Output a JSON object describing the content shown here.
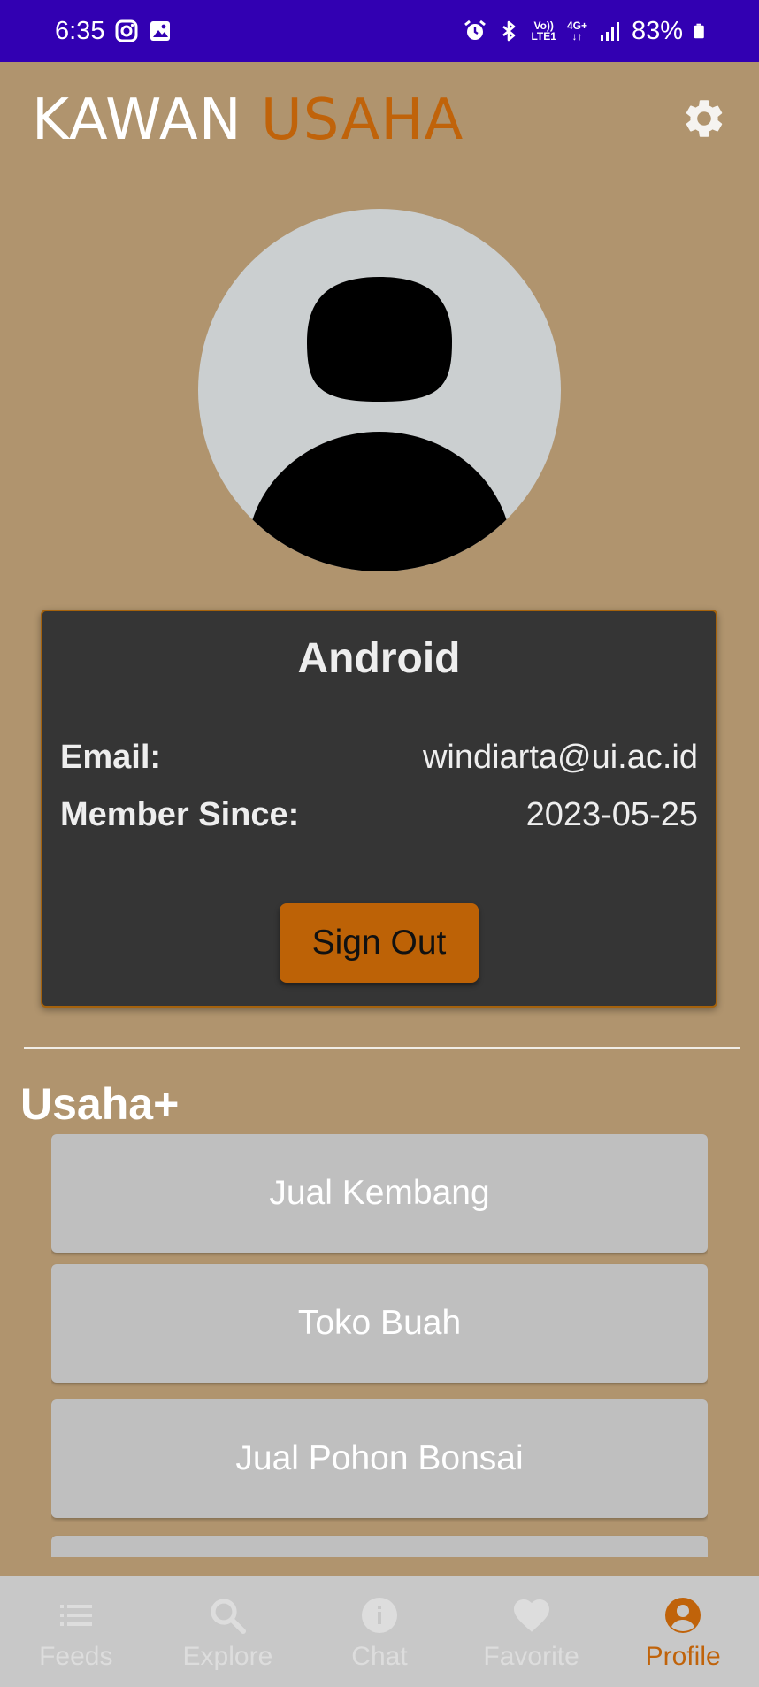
{
  "status_bar": {
    "time": "6:35",
    "volte": "Vo))",
    "lte": "LTE1",
    "network": "4G+",
    "battery": "83%",
    "icons": [
      "instagram-icon",
      "gallery-icon",
      "alarm-icon",
      "bluetooth-icon",
      "signal-icon",
      "battery-icon"
    ]
  },
  "header": {
    "title_part1": "KAWAN",
    "title_part2": "USAHA",
    "settings_icon": "gear-icon"
  },
  "profile": {
    "name": "Android",
    "email_label": "Email:",
    "email": "windiarta@ui.ac.id",
    "member_label": "Member Since:",
    "member_since": "2023-05-25",
    "signout_label": "Sign Out"
  },
  "usaha": {
    "title": "Usaha+",
    "items": [
      "Jual Kembang",
      "Toko Buah",
      "Jual Pohon Bonsai",
      ""
    ]
  },
  "bottom_nav": {
    "items": [
      {
        "label": "Feeds",
        "icon": "list-icon"
      },
      {
        "label": "Explore",
        "icon": "search-icon"
      },
      {
        "label": "Chat",
        "icon": "info-icon"
      },
      {
        "label": "Favorite",
        "icon": "heart-icon"
      },
      {
        "label": "Profile",
        "icon": "account-circle-icon"
      }
    ],
    "active": "Profile"
  },
  "colors": {
    "status_bar": "#3200b2",
    "background": "#b0946e",
    "accent": "#c0630a",
    "card": "#353535",
    "list_item": "#bfbfbf",
    "nav_bar": "#c8c8c8"
  }
}
